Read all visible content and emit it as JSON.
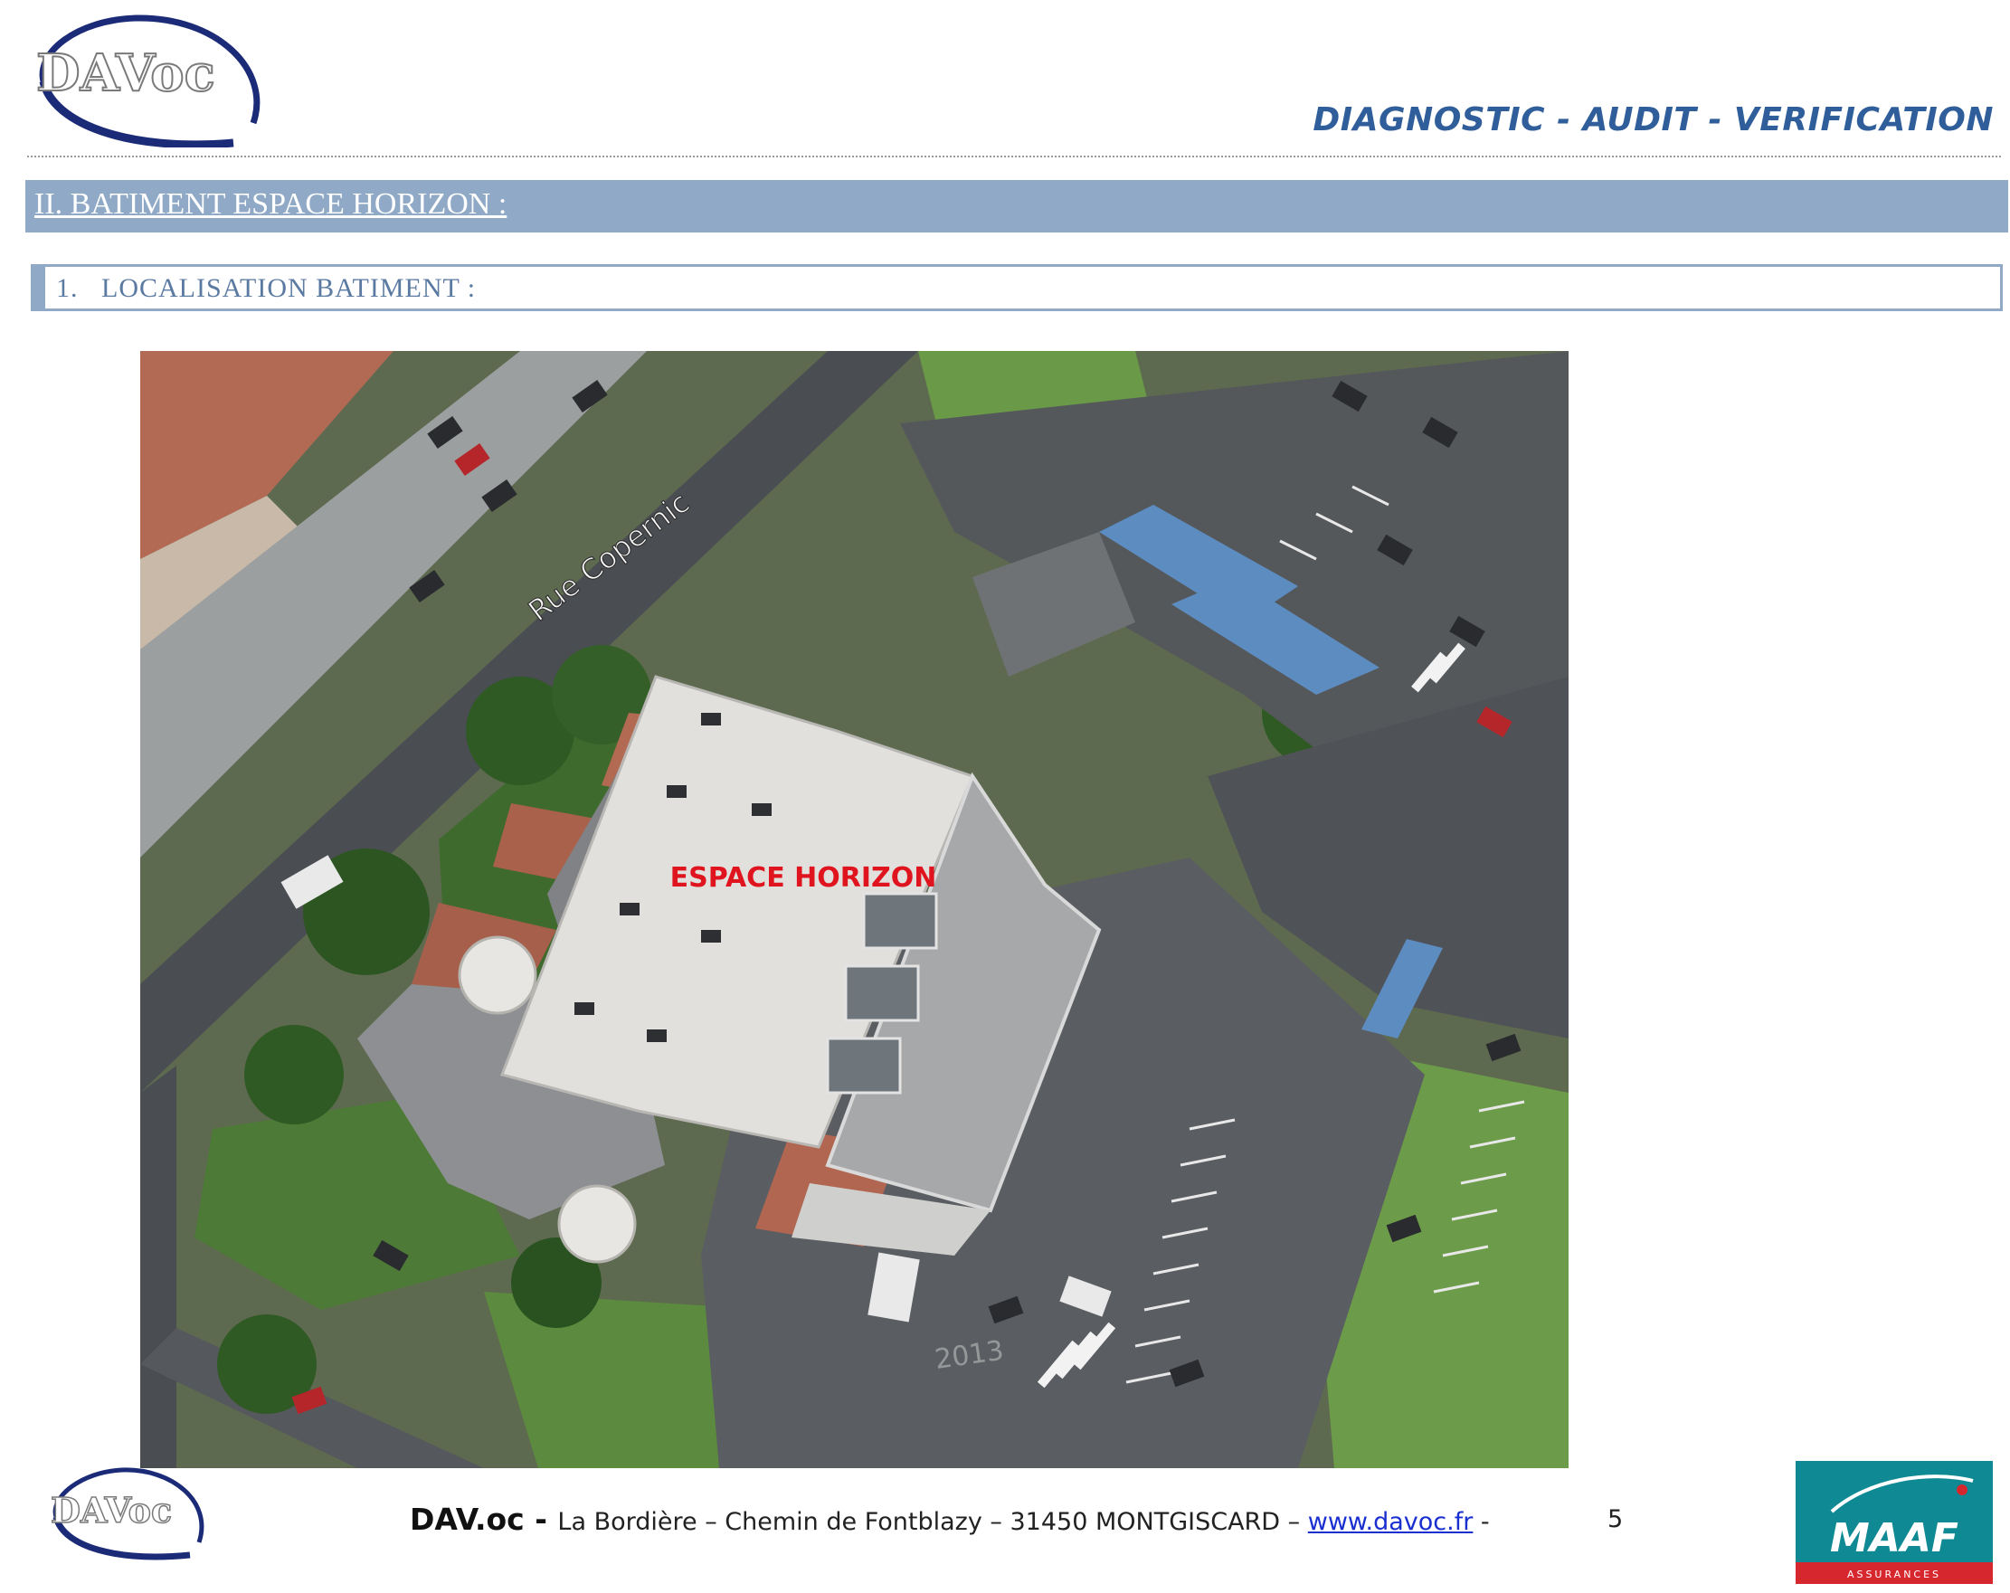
{
  "header": {
    "logo_text": "DAVoc",
    "tagline": "DIAGNOSTIC - AUDIT - VERIFICATION"
  },
  "section": {
    "title": "II. BATIMENT ESPACE HORIZON :"
  },
  "subsection": {
    "title": "1.   LOCALISATION BATIMENT :"
  },
  "photo": {
    "building_label": "ESPACE HORIZON",
    "street_label": "Rue Copernic",
    "watermark": "2013"
  },
  "footer": {
    "brand": "DAV.oc - ",
    "address": "La Bordière – Chemin de Fontblazy – 31450 MONTGISCARD – ",
    "link": "www.davoc.fr",
    "trailing": " -",
    "page_number": "5",
    "logo_text": "DAVoc"
  },
  "partner": {
    "logo_text": "MAAF",
    "logo_subtext": "ASSURANCES"
  },
  "colors": {
    "accent_blue": "#2f5e9a",
    "section_bar": "#8fa9c6",
    "label_red": "#e0141e",
    "maaf_teal": "#0f8a94",
    "maaf_red": "#d6262e"
  }
}
